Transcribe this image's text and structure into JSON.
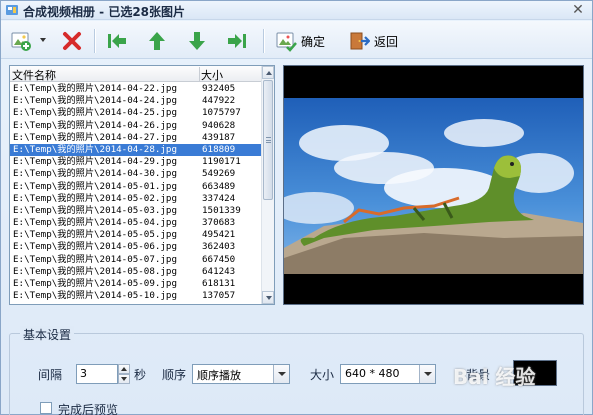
{
  "window": {
    "title": "合成视频相册 - 已选28张图片",
    "close_glyph": "✕"
  },
  "toolbar": {
    "add_icon": "add-image-icon",
    "delete_icon": "delete-x-icon",
    "first_icon": "move-first-icon",
    "up_icon": "move-up-icon",
    "down_icon": "move-down-icon",
    "last_icon": "move-last-icon",
    "confirm_label": "确定",
    "back_label": "返回"
  },
  "filelist": {
    "columns": {
      "name": "文件名称",
      "size": "大小"
    },
    "selected_index": 6,
    "selection_color": "#3a7bd5",
    "rows": [
      {
        "name": "E:\\Temp\\我的照片\\2014-04-22.jpg",
        "size": "932405"
      },
      {
        "name": "E:\\Temp\\我的照片\\2014-04-24.jpg",
        "size": "447922"
      },
      {
        "name": "E:\\Temp\\我的照片\\2014-04-25.jpg",
        "size": "1075797"
      },
      {
        "name": "E:\\Temp\\我的照片\\2014-04-26.jpg",
        "size": "940628"
      },
      {
        "name": "E:\\Temp\\我的照片\\2014-04-27.jpg",
        "size": "439187"
      },
      {
        "name": "E:\\Temp\\我的照片\\2014-04-28.jpg",
        "size": "618809"
      },
      {
        "name": "E:\\Temp\\我的照片\\2014-04-29.jpg",
        "size": "1190171"
      },
      {
        "name": "E:\\Temp\\我的照片\\2014-04-30.jpg",
        "size": "549269"
      },
      {
        "name": "E:\\Temp\\我的照片\\2014-05-01.jpg",
        "size": "663489"
      },
      {
        "name": "E:\\Temp\\我的照片\\2014-05-02.jpg",
        "size": "337424"
      },
      {
        "name": "E:\\Temp\\我的照片\\2014-05-03.jpg",
        "size": "1501339"
      },
      {
        "name": "E:\\Temp\\我的照片\\2014-05-04.jpg",
        "size": "370683"
      },
      {
        "name": "E:\\Temp\\我的照片\\2014-05-05.jpg",
        "size": "495421"
      },
      {
        "name": "E:\\Temp\\我的照片\\2014-05-06.jpg",
        "size": "362403"
      },
      {
        "name": "E:\\Temp\\我的照片\\2014-05-07.jpg",
        "size": "667450"
      },
      {
        "name": "E:\\Temp\\我的照片\\2014-05-08.jpg",
        "size": "641243"
      },
      {
        "name": "E:\\Temp\\我的照片\\2014-05-09.jpg",
        "size": "618131"
      },
      {
        "name": "E:\\Temp\\我的照片\\2014-05-10.jpg",
        "size": "137057"
      }
    ]
  },
  "settings": {
    "legend": "基本设置",
    "interval_label": "间隔",
    "interval_value": "3",
    "interval_unit": "秒",
    "order_label": "顺序",
    "order_value": "顺序播放",
    "size_label": "大小",
    "size_value": "640 * 480",
    "background_label": "背景",
    "background_color": "#000000",
    "preview_after_label": "完成后预览"
  },
  "watermark": "Bai 经验"
}
